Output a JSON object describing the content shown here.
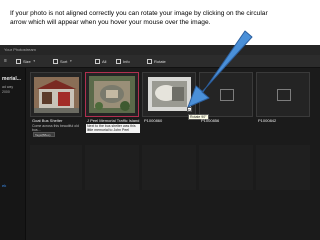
{
  "caption": "If your photo is not aligned correctly you can rotate your image by clicking on the circular arrow which will appear when you hover your mouse over the image.",
  "app": {
    "window_title": "Your Photostream",
    "toolbar": {
      "size_label": "Size",
      "sort_label": "Sort",
      "all_label": "All",
      "info_label": "Info",
      "rotate_label": "Rotate"
    },
    "sidebar": {
      "title": "merial...",
      "line1": "ad way",
      "line2": "2000",
      "link": "ek"
    },
    "photos": [
      {
        "title": "Goat Bus Shelter",
        "desc": "Come across this beautiful old bus...",
        "tags": "Tags(BBus)"
      },
      {
        "title": "J Peel Memorial Traffic Island",
        "desc": "Next to the bus shelter was this little memorial to John Peel"
      },
      {
        "title": "P1000860",
        "tooltip": "Rotate 90°",
        "rotate_icon": "rotate-icon"
      },
      {
        "title": "P1000856"
      },
      {
        "title": "P1000842"
      }
    ]
  },
  "colors": {
    "app_background": "#1b1b1b",
    "selection_border": "#b1304f",
    "arrow_fill": "#4a90d9",
    "link": "#3b8ef0"
  }
}
